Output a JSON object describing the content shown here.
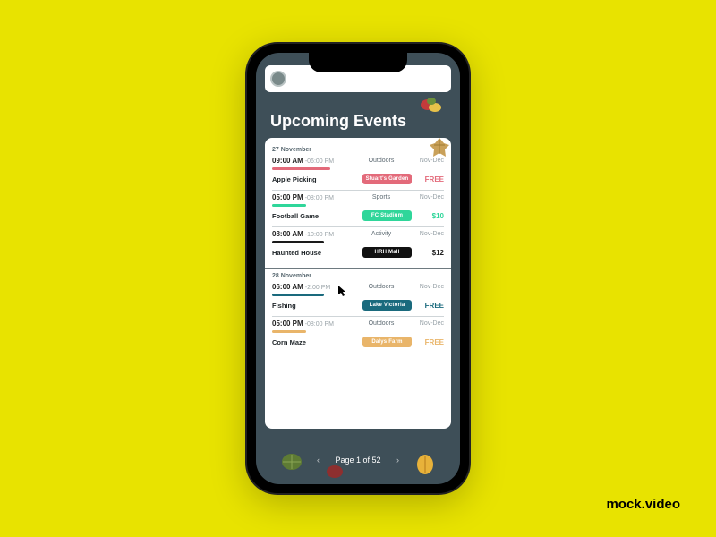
{
  "watermark": "mock.video",
  "title": "Upcoming Events",
  "pager": {
    "prev": "‹",
    "label": "Page 1 of 52",
    "next": "›"
  },
  "colors": {
    "bar_pink": "#e36a7a",
    "bar_green": "#2fd69a",
    "bar_black": "#1a1a1a",
    "bar_teal": "#1a6a7d",
    "bar_orange": "#e9b56a",
    "tag_pink": "#e36a7a",
    "tag_green": "#2fd69a",
    "tag_black": "#111",
    "tag_teal": "#1a6a7d",
    "tag_orange": "#e9b56a",
    "price_pink": "#e36a7a",
    "price_green": "#2fd69a",
    "price_black": "#222",
    "price_teal": "#1a6a7d",
    "price_orange": "#e9b56a"
  },
  "days": [
    {
      "label": "27 November",
      "events": [
        {
          "start": "09:00 AM",
          "end": "-06:00 PM",
          "category": "Outdoors",
          "season": "Nov-Dec",
          "barKey": "bar_pink",
          "barWidth": "34%",
          "name": "Apple Picking",
          "tag": "Stuart's Garden",
          "tagKey": "tag_pink",
          "price": "FREE",
          "priceKey": "price_pink"
        },
        {
          "start": "05:00 PM",
          "end": "-08:00 PM",
          "category": "Sports",
          "season": "Nov-Dec",
          "barKey": "bar_green",
          "barWidth": "20%",
          "name": "Football Game",
          "tag": "FC Stadium",
          "tagKey": "tag_green",
          "price": "$10",
          "priceKey": "price_green"
        },
        {
          "start": "08:00 AM",
          "end": "-10:00 PM",
          "category": "Activity",
          "season": "Nov-Dec",
          "barKey": "bar_black",
          "barWidth": "30%",
          "name": "Haunted House",
          "tag": "HRH Mall",
          "tagKey": "tag_black",
          "price": "$12",
          "priceKey": "price_black"
        }
      ]
    },
    {
      "label": "28 November",
      "events": [
        {
          "start": "06:00 AM",
          "end": "-2:00 PM",
          "category": "Outdoors",
          "season": "Nov-Dec",
          "barKey": "bar_teal",
          "barWidth": "30%",
          "name": "Fishing",
          "tag": "Lake Victoria",
          "tagKey": "tag_teal",
          "price": "FREE",
          "priceKey": "price_teal"
        },
        {
          "start": "05:00 PM",
          "end": "-08:00 PM",
          "category": "Outdoors",
          "season": "Nov-Dec",
          "barKey": "bar_orange",
          "barWidth": "20%",
          "name": "Corn Maze",
          "tag": "Dalys Farm",
          "tagKey": "tag_orange",
          "price": "FREE",
          "priceKey": "price_orange"
        }
      ]
    }
  ]
}
